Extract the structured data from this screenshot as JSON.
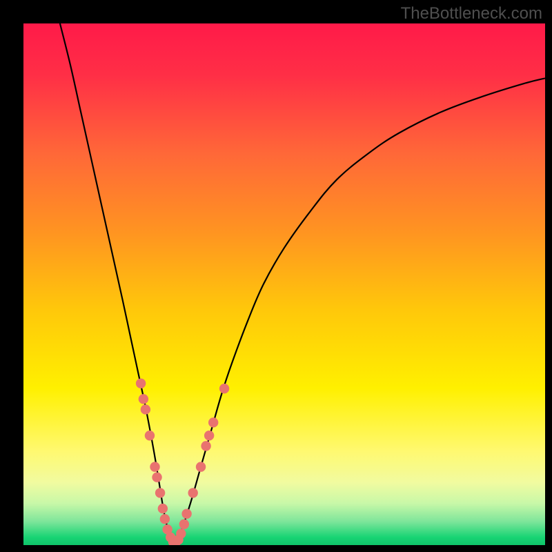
{
  "watermark": "TheBottleneck.com",
  "colors": {
    "frame": "#000000",
    "watermark": "#4f4f4f",
    "curve": "#000000",
    "marker": "#e9736f",
    "marker_stroke": "#b85753",
    "gradient_stops": [
      {
        "offset": 0.0,
        "color": "#ff1a49"
      },
      {
        "offset": 0.1,
        "color": "#ff2f46"
      },
      {
        "offset": 0.25,
        "color": "#ff6838"
      },
      {
        "offset": 0.4,
        "color": "#ff9421"
      },
      {
        "offset": 0.55,
        "color": "#ffc80a"
      },
      {
        "offset": 0.7,
        "color": "#fff000"
      },
      {
        "offset": 0.82,
        "color": "#fff970"
      },
      {
        "offset": 0.88,
        "color": "#f1fba0"
      },
      {
        "offset": 0.92,
        "color": "#c8f8a8"
      },
      {
        "offset": 0.955,
        "color": "#7de59a"
      },
      {
        "offset": 0.985,
        "color": "#18d474"
      },
      {
        "offset": 1.0,
        "color": "#0fc46a"
      }
    ]
  },
  "chart_data": {
    "type": "line",
    "title": "",
    "xlabel": "",
    "ylabel": "",
    "xlim": [
      0,
      100
    ],
    "ylim": [
      0,
      100
    ],
    "series": [
      {
        "name": "bottleneck-curve",
        "x": [
          7,
          9,
          11,
          13,
          15,
          17,
          19,
          20.5,
          22,
          23.5,
          25,
          26,
          27,
          28,
          29,
          30,
          32,
          34,
          36,
          38,
          40,
          43,
          46,
          50,
          55,
          60,
          66,
          72,
          80,
          88,
          96,
          100
        ],
        "y": [
          100,
          92,
          83,
          74,
          65,
          56,
          47,
          40,
          33,
          26,
          18,
          12,
          6,
          2,
          0,
          2,
          8,
          15,
          22,
          29,
          35,
          43,
          50,
          57,
          64,
          70,
          75,
          79,
          83,
          86,
          88.5,
          89.5
        ]
      }
    ],
    "markers": {
      "name": "sample-points",
      "points": [
        {
          "x": 22.5,
          "y": 31
        },
        {
          "x": 23.0,
          "y": 28
        },
        {
          "x": 23.4,
          "y": 26
        },
        {
          "x": 24.2,
          "y": 21
        },
        {
          "x": 25.2,
          "y": 15
        },
        {
          "x": 25.6,
          "y": 13
        },
        {
          "x": 26.2,
          "y": 10
        },
        {
          "x": 26.7,
          "y": 7
        },
        {
          "x": 27.1,
          "y": 5
        },
        {
          "x": 27.6,
          "y": 3
        },
        {
          "x": 28.2,
          "y": 1.5
        },
        {
          "x": 28.7,
          "y": 0.6
        },
        {
          "x": 29.1,
          "y": 0.3
        },
        {
          "x": 29.7,
          "y": 1
        },
        {
          "x": 30.2,
          "y": 2.2
        },
        {
          "x": 30.8,
          "y": 4
        },
        {
          "x": 31.3,
          "y": 6
        },
        {
          "x": 32.5,
          "y": 10
        },
        {
          "x": 34.0,
          "y": 15
        },
        {
          "x": 35.0,
          "y": 19
        },
        {
          "x": 35.6,
          "y": 21
        },
        {
          "x": 36.4,
          "y": 23.5
        },
        {
          "x": 38.5,
          "y": 30
        }
      ]
    }
  }
}
